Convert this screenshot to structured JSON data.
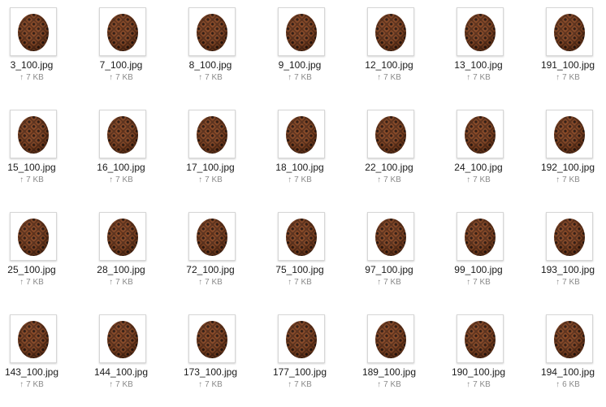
{
  "files": [
    {
      "name": "3_100.jpg",
      "size": "7 KB"
    },
    {
      "name": "7_100.jpg",
      "size": "7 KB"
    },
    {
      "name": "8_100.jpg",
      "size": "7 KB"
    },
    {
      "name": "9_100.jpg",
      "size": "7 KB"
    },
    {
      "name": "12_100.jpg",
      "size": "7 KB"
    },
    {
      "name": "13_100.jpg",
      "size": "7 KB"
    },
    {
      "name": "191_100.jpg",
      "size": "7 KB"
    },
    {
      "name": "15_100.jpg",
      "size": "7 KB"
    },
    {
      "name": "16_100.jpg",
      "size": "7 KB"
    },
    {
      "name": "17_100.jpg",
      "size": "7 KB"
    },
    {
      "name": "18_100.jpg",
      "size": "7 KB"
    },
    {
      "name": "22_100.jpg",
      "size": "7 KB"
    },
    {
      "name": "24_100.jpg",
      "size": "7 KB"
    },
    {
      "name": "192_100.jpg",
      "size": "7 KB"
    },
    {
      "name": "25_100.jpg",
      "size": "7 KB"
    },
    {
      "name": "28_100.jpg",
      "size": "7 KB"
    },
    {
      "name": "72_100.jpg",
      "size": "7 KB"
    },
    {
      "name": "75_100.jpg",
      "size": "7 KB"
    },
    {
      "name": "97_100.jpg",
      "size": "7 KB"
    },
    {
      "name": "99_100.jpg",
      "size": "7 KB"
    },
    {
      "name": "193_100.jpg",
      "size": "7 KB"
    },
    {
      "name": "143_100.jpg",
      "size": "7 KB"
    },
    {
      "name": "144_100.jpg",
      "size": "7 KB"
    },
    {
      "name": "173_100.jpg",
      "size": "7 KB"
    },
    {
      "name": "177_100.jpg",
      "size": "7 KB"
    },
    {
      "name": "189_100.jpg",
      "size": "7 KB"
    },
    {
      "name": "190_100.jpg",
      "size": "7 KB"
    },
    {
      "name": "194_100.jpg",
      "size": "6 KB"
    }
  ],
  "size_icon": "up-arrow-icon",
  "colors": {
    "pine_dark": "#3a2016",
    "pine_mid": "#6e3a1f",
    "pine_light": "#a55a2a"
  }
}
